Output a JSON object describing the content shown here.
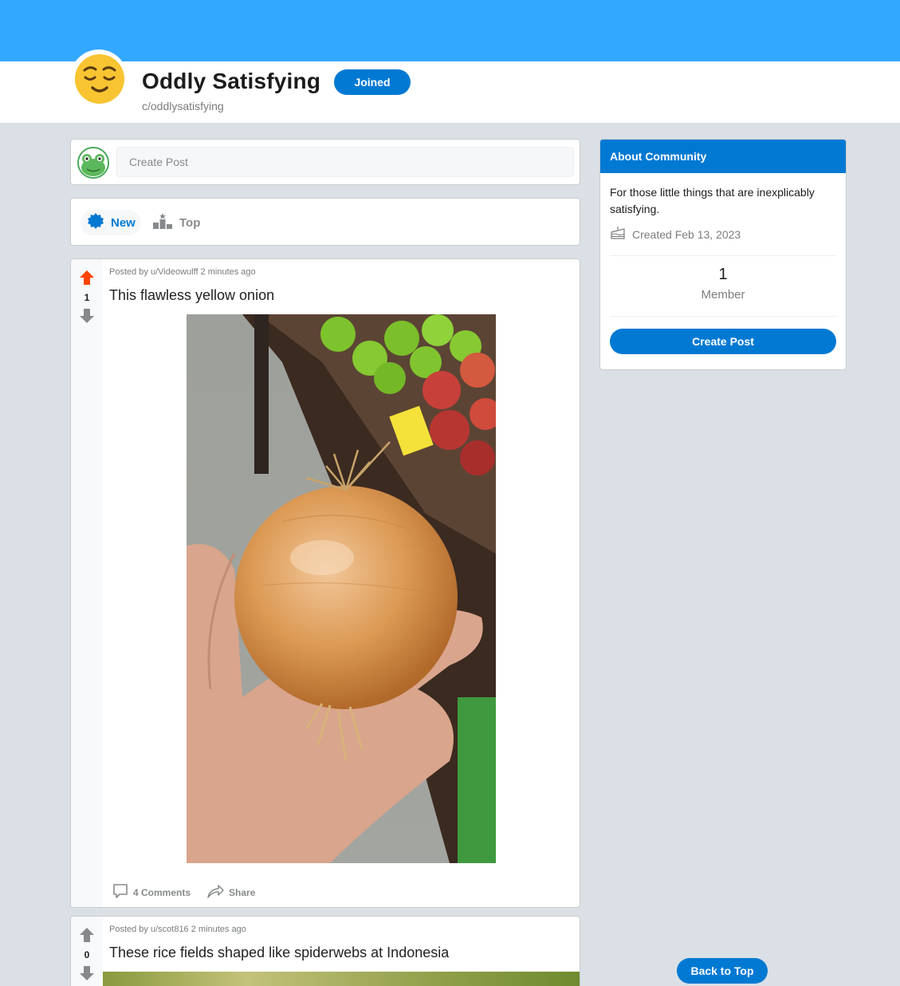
{
  "community": {
    "title": "Oddly Satisfying",
    "name": "c/oddlysatisfying",
    "joined_label": "Joined"
  },
  "create_post": {
    "placeholder": "Create Post"
  },
  "sort": {
    "new_label": "New",
    "top_label": "Top"
  },
  "posts": [
    {
      "meta": "Posted by u/Videowulff 2 minutes ago",
      "score": "1",
      "title": "This flawless yellow onion",
      "comments_label": "4 Comments",
      "share_label": "Share"
    },
    {
      "meta": "Posted by u/scot816 2 minutes ago",
      "score": "0",
      "title": "These rice fields shaped like spiderwebs at Indonesia"
    }
  ],
  "about": {
    "heading": "About Community",
    "description": "For those little things that are inexplicably satisfying.",
    "created": "Created Feb 13, 2023",
    "members_count": "1",
    "members_label": "Member",
    "create_post_label": "Create Post"
  },
  "back_to_top_label": "Back to Top",
  "colors": {
    "banner": "#33a8ff",
    "accent": "#0079d3",
    "upvote_active": "#ff4500",
    "page_bg": "#dae0e6"
  },
  "icons": [
    "relieved-face-icon",
    "frog-avatar-icon",
    "new-badge-icon",
    "top-podium-icon",
    "upvote-arrow-icon",
    "downvote-arrow-icon",
    "comment-icon",
    "share-icon",
    "cake-icon"
  ]
}
